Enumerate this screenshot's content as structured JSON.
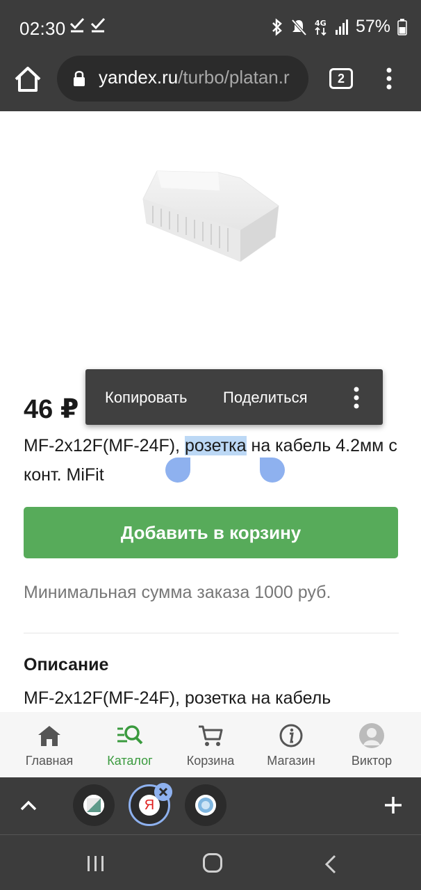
{
  "status_bar": {
    "time": "02:30",
    "battery": "57%",
    "icons": [
      "check-icon",
      "check-icon",
      "bluetooth-icon",
      "mute-icon",
      "4g-icon",
      "signal-icon",
      "battery-icon"
    ]
  },
  "browser": {
    "url_host": "yandex.ru",
    "url_path": "/turbo/platan.r",
    "tab_count": "2"
  },
  "product": {
    "price": "46 ₽",
    "title_before": "MF-2x12F(MF-24F), ",
    "title_selected": "розетка",
    "title_after": " на кабель 4.2мм с конт. Mi",
    "title_tail": "Fit",
    "add_to_cart": "Добавить в корзину",
    "min_order": "Минимальная сумма заказа 1000 руб.",
    "description_heading": "Описание",
    "description_text": "MF-2x12F(MF-24F), розетка на кабель"
  },
  "context_menu": {
    "copy": "Копировать",
    "share": "Поделиться"
  },
  "bottom_nav": {
    "items": [
      {
        "label": "Главная",
        "icon": "home-icon"
      },
      {
        "label": "Каталог",
        "icon": "catalog-search-icon"
      },
      {
        "label": "Корзина",
        "icon": "cart-icon"
      },
      {
        "label": "Магазин",
        "icon": "info-icon"
      },
      {
        "label": "Виктор",
        "icon": "avatar-icon"
      }
    ],
    "active_index": 1
  },
  "tab_switcher": {
    "yandex_letter": "Я"
  },
  "colors": {
    "accent_green": "#57ab5a",
    "selection": "#bcd8f5",
    "handle_blue": "#8eb1ef",
    "chrome_dark": "#3c3c3c"
  }
}
